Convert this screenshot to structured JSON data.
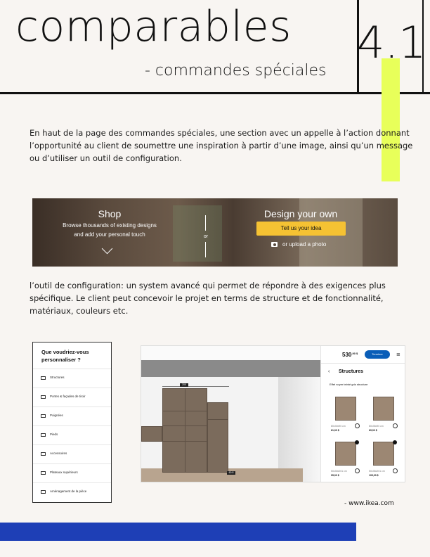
{
  "header": {
    "title": "comparables",
    "subtitle": "- commandes spéciales",
    "section_number": "4.1"
  },
  "paragraphs": {
    "p1": "En haut de la page des commandes spéciales, une section avec un appelle à l’action donnant l’opportunité au client de soumettre une inspiration à partir d’une image, ainsi qu’un message ou d’utiliser un outil de configuration.",
    "p2": "l’outil de configuration: un system avancé qui permet de répondre à des exigences plus spécifique. Le client peut concevoir le projet en terms de structure et de fonctionnalité, matériaux, couleurs etc."
  },
  "banner": {
    "shop_heading": "Shop",
    "shop_line1": "Browse thousands of existing designs",
    "shop_line2": "and add your personal touch",
    "or_label": "or",
    "design_heading": "Design your own",
    "tell_button": "Tell us your idea",
    "upload_label": "or upload a photo"
  },
  "menu": {
    "title": "Que voudriez-vous personnaliser ?",
    "items": [
      "Structures",
      "Portes & façades de tiroir",
      "Poignées",
      "Pieds",
      "Accessoires",
      "Plateaux supérieurs",
      "Aménagement de la pièce"
    ]
  },
  "configurator": {
    "price": "530",
    "price_cents": ",90 $",
    "finish_button": "Terminer",
    "panel_title": "Structures",
    "panel_subtitle": "Effet noyer teinté gris structure",
    "dim_top": "200",
    "dim_bottom": "60.8",
    "cards": [
      {
        "caption": "80x30x90 cm",
        "price": "61,00 $"
      },
      {
        "caption": "80x35x90 cm",
        "price": "69,00 $"
      },
      {
        "caption": "50x30x201 cm",
        "price": "95,00 $"
      },
      {
        "caption": "50x35x201 cm",
        "price": "105,00 $"
      }
    ]
  },
  "source": "- www.ikea.com",
  "colors": {
    "accent_yellow": "#e8ff5a",
    "footer_blue": "#1e3fb6",
    "ikea_yellow": "#f5c233",
    "ikea_blue": "#0a5eb8"
  }
}
